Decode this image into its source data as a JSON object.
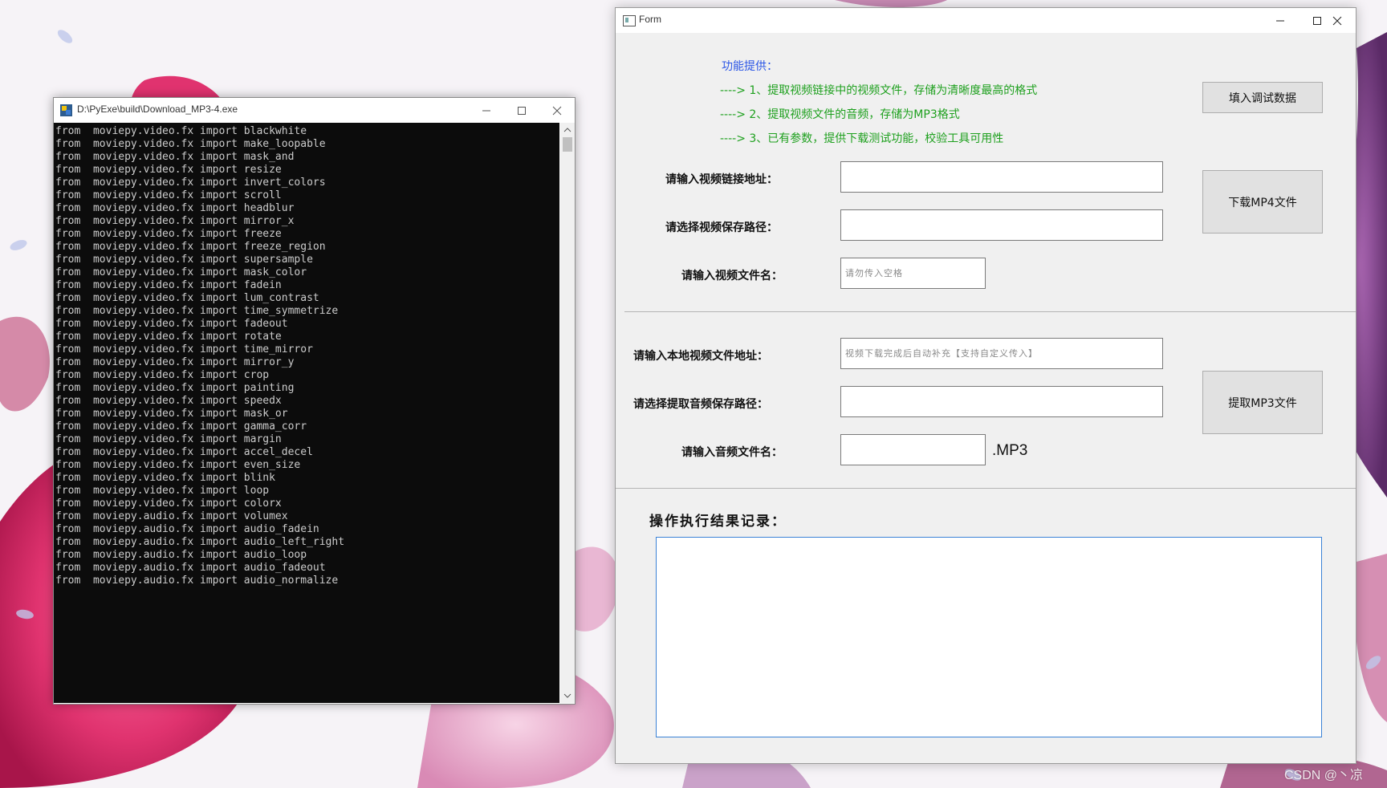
{
  "console": {
    "title": "D:\\PyExe\\build\\Download_MP3-4.exe",
    "lines": [
      "from  moviepy.video.fx import blackwhite",
      "from  moviepy.video.fx import make_loopable",
      "from  moviepy.video.fx import mask_and",
      "from  moviepy.video.fx import resize",
      "from  moviepy.video.fx import invert_colors",
      "from  moviepy.video.fx import scroll",
      "from  moviepy.video.fx import headblur",
      "from  moviepy.video.fx import mirror_x",
      "from  moviepy.video.fx import freeze",
      "from  moviepy.video.fx import freeze_region",
      "from  moviepy.video.fx import supersample",
      "from  moviepy.video.fx import mask_color",
      "from  moviepy.video.fx import fadein",
      "from  moviepy.video.fx import lum_contrast",
      "from  moviepy.video.fx import time_symmetrize",
      "from  moviepy.video.fx import fadeout",
      "from  moviepy.video.fx import rotate",
      "from  moviepy.video.fx import time_mirror",
      "from  moviepy.video.fx import mirror_y",
      "from  moviepy.video.fx import crop",
      "from  moviepy.video.fx import painting",
      "from  moviepy.video.fx import speedx",
      "from  moviepy.video.fx import mask_or",
      "from  moviepy.video.fx import gamma_corr",
      "from  moviepy.video.fx import margin",
      "from  moviepy.video.fx import accel_decel",
      "from  moviepy.video.fx import even_size",
      "from  moviepy.video.fx import blink",
      "from  moviepy.video.fx import loop",
      "from  moviepy.video.fx import colorx",
      "from  moviepy.audio.fx import volumex",
      "from  moviepy.audio.fx import audio_fadein",
      "from  moviepy.audio.fx import audio_left_right",
      "from  moviepy.audio.fx import audio_loop",
      "from  moviepy.audio.fx import audio_fadeout",
      "from  moviepy.audio.fx import audio_normalize"
    ]
  },
  "form": {
    "title": "Form",
    "intro": {
      "title": "功能提供：",
      "items": [
        "---->  1、提取视频链接中的视频文件，存储为清晰度最高的格式",
        "---->  2、提取视频文件的音频，存储为MP3格式",
        "---->  3、已有参数，提供下载测试功能，校验工具可用性"
      ]
    },
    "fill_debug_button": "填入调试数据",
    "video_url_label": "请输入视频链接地址：",
    "video_url_value": "",
    "video_save_path_label": "请选择视频保存路径：",
    "video_save_path_value": "",
    "video_filename_label": "请输入视频文件名：",
    "video_filename_placeholder": "请勿传入空格",
    "download_mp4_button": "下载MP4文件",
    "local_video_label": "请输入本地视频文件地址：",
    "local_video_placeholder": "视频下载完成后自动补充【支持自定义传入】",
    "audio_save_path_label": "请选择提取音频保存路径：",
    "audio_save_path_value": "",
    "audio_filename_label": "请输入音频文件名：",
    "audio_filename_value": "",
    "audio_suffix": ".MP3",
    "extract_mp3_button": "提取MP3文件",
    "result_label": "操作执行结果记录：",
    "result_value": ""
  },
  "watermark": "CSDN @丶凉",
  "colors": {
    "console_bg": "#0c0c0c",
    "console_text": "#cccccc",
    "intro_title": "#2a55e6",
    "intro_items": "#1ea01e",
    "result_border": "#3a82d6"
  },
  "icons": [
    "python-exe-icon",
    "minimize-icon",
    "maximize-icon",
    "close-icon",
    "scroll-up-icon",
    "scroll-down-icon",
    "form-window-icon"
  ]
}
